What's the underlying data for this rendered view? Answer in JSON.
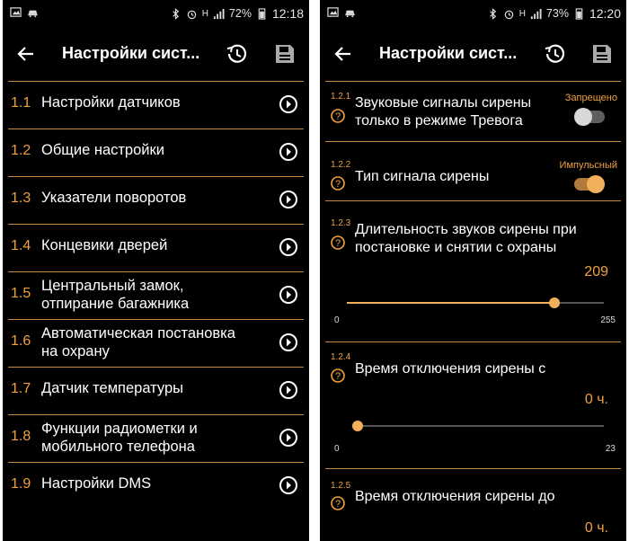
{
  "colors": {
    "accent": "#f0a040",
    "divider": "#c88a42",
    "background": "#000000"
  },
  "left": {
    "statusbar": {
      "battery": "72%",
      "time": "12:18",
      "network": "H"
    },
    "toolbar": {
      "title": "Настройки сист..."
    },
    "items": [
      {
        "num": "1.1",
        "label": "Настройки датчиков"
      },
      {
        "num": "1.2",
        "label": "Общие настройки"
      },
      {
        "num": "1.3",
        "label": "Указатели поворотов"
      },
      {
        "num": "1.4",
        "label": "Концевики дверей"
      },
      {
        "num": "1.5",
        "label": "Центральный замок,\nотпирание багажника"
      },
      {
        "num": "1.6",
        "label": "Автоматическая постановка\nна охрану"
      },
      {
        "num": "1.7",
        "label": "Датчик температуры"
      },
      {
        "num": "1.8",
        "label": "Функции радиометки и\nмобильного телефона"
      },
      {
        "num": "1.9",
        "label": "Настройки DMS"
      }
    ]
  },
  "right": {
    "statusbar": {
      "battery": "73%",
      "time": "12:20",
      "network": "H"
    },
    "toolbar": {
      "title": "Настройки сист..."
    },
    "settings": {
      "s121": {
        "num": "1.2.1",
        "label": "Звуковые сигналы сирены\nтолько в режиме Тревога",
        "state": "Запрещено",
        "on": false
      },
      "s122": {
        "num": "1.2.2",
        "label": "Тип сигнала сирены",
        "state": "Импульсный",
        "on": true
      },
      "s123": {
        "num": "1.2.3",
        "label": "Длительность звуков сирены при\nпостановке и снятии с охраны",
        "value": "209",
        "min": "0",
        "max": "255",
        "level": 0.82
      },
      "s124": {
        "num": "1.2.4",
        "label": "Время отключения сирены с",
        "value": "0 ч.",
        "min": "0",
        "max": "23",
        "level": 0.0
      },
      "s125": {
        "num": "1.2.5",
        "label": "Время отключения сирены до",
        "value": "0 ч."
      }
    }
  }
}
